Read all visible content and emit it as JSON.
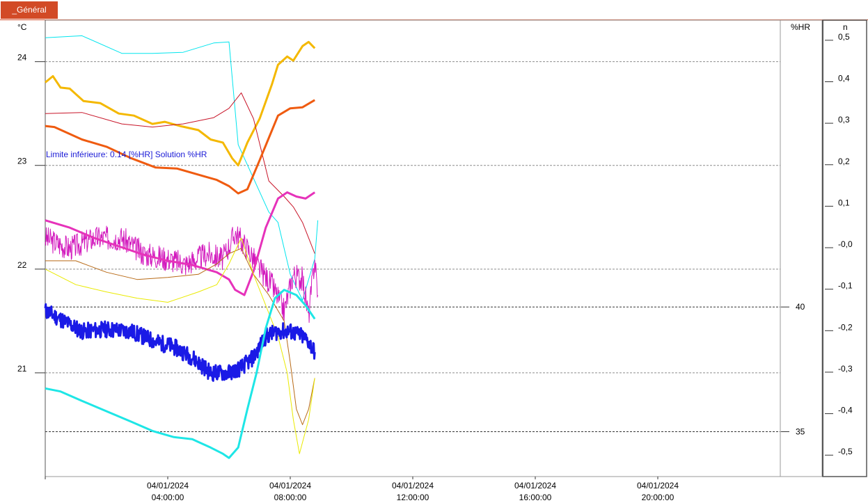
{
  "tab": {
    "label": "_Général"
  },
  "chart_data": {
    "type": "line",
    "x_range_hours": [
      0,
      24
    ],
    "x_ticks": [
      {
        "hour": 4,
        "date": "04/01/2024",
        "time": "04:00:00"
      },
      {
        "hour": 8,
        "date": "04/01/2024",
        "time": "08:00:00"
      },
      {
        "hour": 12,
        "date": "04/01/2024",
        "time": "12:00:00"
      },
      {
        "hour": 16,
        "date": "04/01/2024",
        "time": "16:00:00"
      },
      {
        "hour": 20,
        "date": "04/01/2024",
        "time": "20:00:00"
      }
    ],
    "left_axis": {
      "unit": "°C",
      "range": [
        20.0,
        24.4
      ],
      "ticks": [
        24,
        23,
        22,
        21
      ]
    },
    "mid_axis": {
      "unit": "%HR",
      "range": [
        33.2,
        51.5
      ],
      "ticks": [
        40,
        35
      ]
    },
    "right_axis": {
      "unit": "n",
      "range": [
        -0.56,
        0.54
      ],
      "ticks": [
        "0,5",
        "0,4",
        "0,3",
        "0,2",
        "0,1",
        "-0,0",
        "-0,1",
        "-0,2",
        "-0,3",
        "-0,4",
        "-0,5"
      ]
    },
    "annotation": "Limite inférieure: 0.14 [%HR] Solution %HR",
    "annotation_value": 40,
    "grid": "horizontal dashed",
    "series": [
      {
        "color": "#00e5ee",
        "width": 1,
        "noise": 0,
        "seed": 0,
        "points": [
          [
            0,
            24.23
          ],
          [
            1.2,
            24.25
          ],
          [
            2.5,
            24.08
          ],
          [
            3.5,
            24.08
          ],
          [
            4.5,
            24.09
          ],
          [
            5.5,
            24.18
          ],
          [
            6.0,
            24.19
          ],
          [
            6.3,
            23.2
          ],
          [
            7.3,
            22.55
          ],
          [
            7.6,
            22.45
          ],
          [
            8.0,
            21.95
          ],
          [
            8.4,
            21.7
          ],
          [
            8.8,
            22.1
          ],
          [
            8.9,
            22.47
          ]
        ]
      },
      {
        "color": "#f4b800",
        "width": 3,
        "noise": 0,
        "seed": 0,
        "points": [
          [
            0,
            23.8
          ],
          [
            0.25,
            23.86
          ],
          [
            0.5,
            23.75
          ],
          [
            0.8,
            23.74
          ],
          [
            1.25,
            23.62
          ],
          [
            1.8,
            23.6
          ],
          [
            2.4,
            23.5
          ],
          [
            2.9,
            23.48
          ],
          [
            3.5,
            23.4
          ],
          [
            3.9,
            23.42
          ],
          [
            4.4,
            23.38
          ],
          [
            5.0,
            23.34
          ],
          [
            5.4,
            23.25
          ],
          [
            5.8,
            23.22
          ],
          [
            6.1,
            23.07
          ],
          [
            6.3,
            23.0
          ],
          [
            6.6,
            23.22
          ],
          [
            7.0,
            23.45
          ],
          [
            7.4,
            23.78
          ],
          [
            7.6,
            23.97
          ],
          [
            7.9,
            24.05
          ],
          [
            8.1,
            24.01
          ],
          [
            8.4,
            24.15
          ],
          [
            8.6,
            24.19
          ],
          [
            8.8,
            24.13
          ]
        ]
      },
      {
        "color": "#c81428",
        "width": 1,
        "noise": 0,
        "seed": 0,
        "points": [
          [
            0,
            23.5
          ],
          [
            1.2,
            23.51
          ],
          [
            2.5,
            23.4
          ],
          [
            3.5,
            23.37
          ],
          [
            4.5,
            23.4
          ],
          [
            5.5,
            23.46
          ],
          [
            6.0,
            23.55
          ],
          [
            6.4,
            23.7
          ],
          [
            6.8,
            23.45
          ],
          [
            7.3,
            22.85
          ],
          [
            7.8,
            22.7
          ],
          [
            8.1,
            22.6
          ],
          [
            8.4,
            22.45
          ],
          [
            8.6,
            22.3
          ],
          [
            8.8,
            22.15
          ]
        ]
      },
      {
        "color": "#ef5b10",
        "width": 3,
        "noise": 0,
        "seed": 0,
        "points": [
          [
            0,
            23.38
          ],
          [
            0.3,
            23.37
          ],
          [
            1.2,
            23.25
          ],
          [
            2.0,
            23.18
          ],
          [
            2.8,
            23.07
          ],
          [
            3.6,
            22.98
          ],
          [
            4.3,
            22.97
          ],
          [
            5.0,
            22.91
          ],
          [
            5.6,
            22.86
          ],
          [
            6.0,
            22.8
          ],
          [
            6.3,
            22.73
          ],
          [
            6.6,
            22.77
          ],
          [
            7.0,
            23.05
          ],
          [
            7.6,
            23.48
          ],
          [
            8.0,
            23.55
          ],
          [
            8.4,
            23.56
          ],
          [
            8.8,
            23.63
          ]
        ]
      },
      {
        "color": "#d219bd",
        "width": 1,
        "noise": 0.12,
        "seed": 3,
        "points": [
          [
            0,
            22.3
          ],
          [
            0.8,
            22.2
          ],
          [
            1.6,
            22.3
          ],
          [
            2.5,
            22.3
          ],
          [
            3.2,
            22.15
          ],
          [
            4.0,
            22.1
          ],
          [
            4.6,
            22.05
          ],
          [
            5.3,
            22.15
          ],
          [
            5.8,
            22.1
          ],
          [
            6.2,
            22.35
          ],
          [
            6.6,
            22.2
          ],
          [
            7.0,
            22.0
          ],
          [
            7.4,
            21.85
          ],
          [
            7.8,
            21.6
          ],
          [
            8.1,
            21.95
          ],
          [
            8.4,
            21.9
          ],
          [
            8.6,
            21.55
          ],
          [
            8.8,
            22.1
          ],
          [
            8.9,
            21.75
          ]
        ]
      },
      {
        "color": "#e632ba",
        "width": 3,
        "noise": 0,
        "seed": 0,
        "points": [
          [
            0,
            22.47
          ],
          [
            0.8,
            22.4
          ],
          [
            1.6,
            22.3
          ],
          [
            2.4,
            22.22
          ],
          [
            3.2,
            22.14
          ],
          [
            4.0,
            22.08
          ],
          [
            4.8,
            22.04
          ],
          [
            5.6,
            21.97
          ],
          [
            6.0,
            21.9
          ],
          [
            6.2,
            21.8
          ],
          [
            6.5,
            21.75
          ],
          [
            6.8,
            21.98
          ],
          [
            7.2,
            22.4
          ],
          [
            7.6,
            22.68
          ],
          [
            7.9,
            22.74
          ],
          [
            8.2,
            22.7
          ],
          [
            8.5,
            22.68
          ],
          [
            8.8,
            22.74
          ]
        ]
      },
      {
        "color": "#b86a16",
        "width": 1,
        "noise": 0,
        "seed": 0,
        "points": [
          [
            0,
            22.08
          ],
          [
            1.0,
            22.08
          ],
          [
            2.0,
            21.97
          ],
          [
            3.0,
            21.9
          ],
          [
            4.0,
            21.92
          ],
          [
            5.0,
            21.95
          ],
          [
            5.6,
            22.05
          ],
          [
            6.0,
            22.15
          ],
          [
            6.4,
            22.2
          ],
          [
            6.8,
            21.95
          ],
          [
            7.3,
            21.75
          ],
          [
            7.8,
            21.5
          ],
          [
            8.0,
            21.1
          ],
          [
            8.2,
            20.65
          ],
          [
            8.4,
            20.5
          ],
          [
            8.6,
            20.65
          ],
          [
            8.8,
            20.95
          ]
        ]
      },
      {
        "color": "#eaea00",
        "width": 1,
        "noise": 0,
        "seed": 0,
        "points": [
          [
            0,
            22.0
          ],
          [
            1.0,
            21.85
          ],
          [
            2.0,
            21.78
          ],
          [
            3.0,
            21.72
          ],
          [
            4.0,
            21.68
          ],
          [
            5.0,
            21.78
          ],
          [
            5.6,
            21.85
          ],
          [
            6.0,
            22.05
          ],
          [
            6.4,
            22.3
          ],
          [
            6.8,
            21.95
          ],
          [
            7.2,
            21.65
          ],
          [
            7.6,
            21.35
          ],
          [
            7.9,
            21.0
          ],
          [
            8.1,
            20.55
          ],
          [
            8.3,
            20.22
          ],
          [
            8.6,
            20.55
          ],
          [
            8.8,
            20.95
          ]
        ]
      },
      {
        "color": "#1a1ae6",
        "width": 3,
        "noise": 0.08,
        "seed": 11,
        "points": [
          [
            0,
            21.6
          ],
          [
            0.6,
            21.5
          ],
          [
            1.2,
            21.4
          ],
          [
            2.0,
            21.42
          ],
          [
            2.8,
            21.4
          ],
          [
            3.6,
            21.3
          ],
          [
            4.2,
            21.25
          ],
          [
            4.8,
            21.15
          ],
          [
            5.4,
            21.0
          ],
          [
            6.0,
            21.0
          ],
          [
            6.4,
            21.05
          ],
          [
            6.8,
            21.15
          ],
          [
            7.2,
            21.35
          ],
          [
            7.6,
            21.4
          ],
          [
            8.0,
            21.4
          ],
          [
            8.4,
            21.35
          ],
          [
            8.6,
            21.3
          ],
          [
            8.8,
            21.2
          ]
        ]
      },
      {
        "color": "#1ee6e6",
        "width": 3,
        "noise": 0,
        "seed": 0,
        "points": [
          [
            0,
            20.85
          ],
          [
            0.5,
            20.82
          ],
          [
            1.2,
            20.73
          ],
          [
            2.0,
            20.63
          ],
          [
            2.8,
            20.53
          ],
          [
            3.5,
            20.44
          ],
          [
            4.2,
            20.38
          ],
          [
            4.8,
            20.36
          ],
          [
            5.4,
            20.28
          ],
          [
            5.8,
            20.22
          ],
          [
            6.0,
            20.18
          ],
          [
            6.3,
            20.28
          ],
          [
            6.6,
            20.65
          ],
          [
            6.9,
            21.0
          ],
          [
            7.2,
            21.43
          ],
          [
            7.5,
            21.72
          ],
          [
            7.8,
            21.8
          ],
          [
            8.2,
            21.75
          ],
          [
            8.5,
            21.65
          ],
          [
            8.8,
            21.52
          ]
        ]
      }
    ]
  }
}
